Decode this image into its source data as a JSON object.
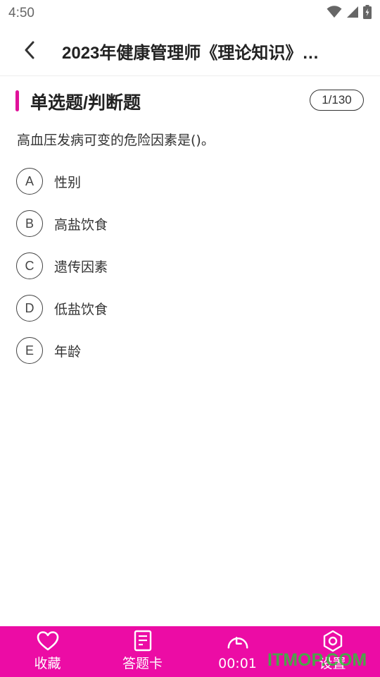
{
  "status_bar": {
    "time": "4:50"
  },
  "header": {
    "title": "2023年健康管理师《理论知识》…"
  },
  "section": {
    "title": "单选题/判断题",
    "progress": "1/130",
    "accent_color": "#e0129a"
  },
  "question": {
    "text": "高血压发病可变的危险因素是()。"
  },
  "options": [
    {
      "letter": "A",
      "text": "性别"
    },
    {
      "letter": "B",
      "text": "高盐饮食"
    },
    {
      "letter": "C",
      "text": "遗传因素"
    },
    {
      "letter": "D",
      "text": "低盐饮食"
    },
    {
      "letter": "E",
      "text": "年龄"
    }
  ],
  "bottom_bar": {
    "background": "#ec0ca5",
    "items": [
      {
        "label": "收藏",
        "icon": "heart-icon"
      },
      {
        "label": "答题卡",
        "icon": "answer-sheet-icon"
      },
      {
        "label": "00:01",
        "icon": "timer-icon"
      },
      {
        "label": "设置",
        "icon": "settings-icon"
      }
    ]
  },
  "watermark": "ITMOP.COM"
}
